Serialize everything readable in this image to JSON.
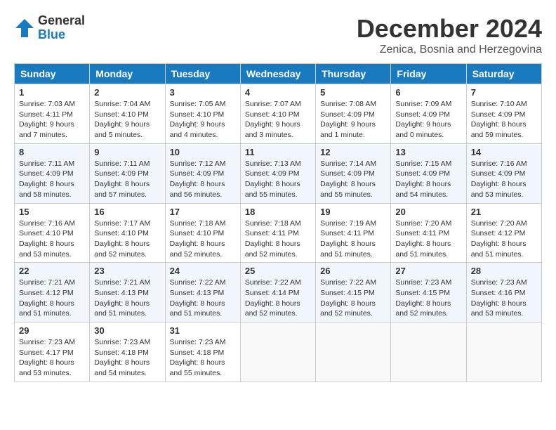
{
  "logo": {
    "general": "General",
    "blue": "Blue"
  },
  "title": "December 2024",
  "location": "Zenica, Bosnia and Herzegovina",
  "days_of_week": [
    "Sunday",
    "Monday",
    "Tuesday",
    "Wednesday",
    "Thursday",
    "Friday",
    "Saturday"
  ],
  "weeks": [
    [
      {
        "day": "1",
        "sunrise": "Sunrise: 7:03 AM",
        "sunset": "Sunset: 4:11 PM",
        "daylight": "Daylight: 9 hours and 7 minutes."
      },
      {
        "day": "2",
        "sunrise": "Sunrise: 7:04 AM",
        "sunset": "Sunset: 4:10 PM",
        "daylight": "Daylight: 9 hours and 5 minutes."
      },
      {
        "day": "3",
        "sunrise": "Sunrise: 7:05 AM",
        "sunset": "Sunset: 4:10 PM",
        "daylight": "Daylight: 9 hours and 4 minutes."
      },
      {
        "day": "4",
        "sunrise": "Sunrise: 7:07 AM",
        "sunset": "Sunset: 4:10 PM",
        "daylight": "Daylight: 9 hours and 3 minutes."
      },
      {
        "day": "5",
        "sunrise": "Sunrise: 7:08 AM",
        "sunset": "Sunset: 4:09 PM",
        "daylight": "Daylight: 9 hours and 1 minute."
      },
      {
        "day": "6",
        "sunrise": "Sunrise: 7:09 AM",
        "sunset": "Sunset: 4:09 PM",
        "daylight": "Daylight: 9 hours and 0 minutes."
      },
      {
        "day": "7",
        "sunrise": "Sunrise: 7:10 AM",
        "sunset": "Sunset: 4:09 PM",
        "daylight": "Daylight: 8 hours and 59 minutes."
      }
    ],
    [
      {
        "day": "8",
        "sunrise": "Sunrise: 7:11 AM",
        "sunset": "Sunset: 4:09 PM",
        "daylight": "Daylight: 8 hours and 58 minutes."
      },
      {
        "day": "9",
        "sunrise": "Sunrise: 7:11 AM",
        "sunset": "Sunset: 4:09 PM",
        "daylight": "Daylight: 8 hours and 57 minutes."
      },
      {
        "day": "10",
        "sunrise": "Sunrise: 7:12 AM",
        "sunset": "Sunset: 4:09 PM",
        "daylight": "Daylight: 8 hours and 56 minutes."
      },
      {
        "day": "11",
        "sunrise": "Sunrise: 7:13 AM",
        "sunset": "Sunset: 4:09 PM",
        "daylight": "Daylight: 8 hours and 55 minutes."
      },
      {
        "day": "12",
        "sunrise": "Sunrise: 7:14 AM",
        "sunset": "Sunset: 4:09 PM",
        "daylight": "Daylight: 8 hours and 55 minutes."
      },
      {
        "day": "13",
        "sunrise": "Sunrise: 7:15 AM",
        "sunset": "Sunset: 4:09 PM",
        "daylight": "Daylight: 8 hours and 54 minutes."
      },
      {
        "day": "14",
        "sunrise": "Sunrise: 7:16 AM",
        "sunset": "Sunset: 4:09 PM",
        "daylight": "Daylight: 8 hours and 53 minutes."
      }
    ],
    [
      {
        "day": "15",
        "sunrise": "Sunrise: 7:16 AM",
        "sunset": "Sunset: 4:10 PM",
        "daylight": "Daylight: 8 hours and 53 minutes."
      },
      {
        "day": "16",
        "sunrise": "Sunrise: 7:17 AM",
        "sunset": "Sunset: 4:10 PM",
        "daylight": "Daylight: 8 hours and 52 minutes."
      },
      {
        "day": "17",
        "sunrise": "Sunrise: 7:18 AM",
        "sunset": "Sunset: 4:10 PM",
        "daylight": "Daylight: 8 hours and 52 minutes."
      },
      {
        "day": "18",
        "sunrise": "Sunrise: 7:18 AM",
        "sunset": "Sunset: 4:11 PM",
        "daylight": "Daylight: 8 hours and 52 minutes."
      },
      {
        "day": "19",
        "sunrise": "Sunrise: 7:19 AM",
        "sunset": "Sunset: 4:11 PM",
        "daylight": "Daylight: 8 hours and 51 minutes."
      },
      {
        "day": "20",
        "sunrise": "Sunrise: 7:20 AM",
        "sunset": "Sunset: 4:11 PM",
        "daylight": "Daylight: 8 hours and 51 minutes."
      },
      {
        "day": "21",
        "sunrise": "Sunrise: 7:20 AM",
        "sunset": "Sunset: 4:12 PM",
        "daylight": "Daylight: 8 hours and 51 minutes."
      }
    ],
    [
      {
        "day": "22",
        "sunrise": "Sunrise: 7:21 AM",
        "sunset": "Sunset: 4:12 PM",
        "daylight": "Daylight: 8 hours and 51 minutes."
      },
      {
        "day": "23",
        "sunrise": "Sunrise: 7:21 AM",
        "sunset": "Sunset: 4:13 PM",
        "daylight": "Daylight: 8 hours and 51 minutes."
      },
      {
        "day": "24",
        "sunrise": "Sunrise: 7:22 AM",
        "sunset": "Sunset: 4:13 PM",
        "daylight": "Daylight: 8 hours and 51 minutes."
      },
      {
        "day": "25",
        "sunrise": "Sunrise: 7:22 AM",
        "sunset": "Sunset: 4:14 PM",
        "daylight": "Daylight: 8 hours and 52 minutes."
      },
      {
        "day": "26",
        "sunrise": "Sunrise: 7:22 AM",
        "sunset": "Sunset: 4:15 PM",
        "daylight": "Daylight: 8 hours and 52 minutes."
      },
      {
        "day": "27",
        "sunrise": "Sunrise: 7:23 AM",
        "sunset": "Sunset: 4:15 PM",
        "daylight": "Daylight: 8 hours and 52 minutes."
      },
      {
        "day": "28",
        "sunrise": "Sunrise: 7:23 AM",
        "sunset": "Sunset: 4:16 PM",
        "daylight": "Daylight: 8 hours and 53 minutes."
      }
    ],
    [
      {
        "day": "29",
        "sunrise": "Sunrise: 7:23 AM",
        "sunset": "Sunset: 4:17 PM",
        "daylight": "Daylight: 8 hours and 53 minutes."
      },
      {
        "day": "30",
        "sunrise": "Sunrise: 7:23 AM",
        "sunset": "Sunset: 4:18 PM",
        "daylight": "Daylight: 8 hours and 54 minutes."
      },
      {
        "day": "31",
        "sunrise": "Sunrise: 7:23 AM",
        "sunset": "Sunset: 4:18 PM",
        "daylight": "Daylight: 8 hours and 55 minutes."
      },
      null,
      null,
      null,
      null
    ]
  ]
}
